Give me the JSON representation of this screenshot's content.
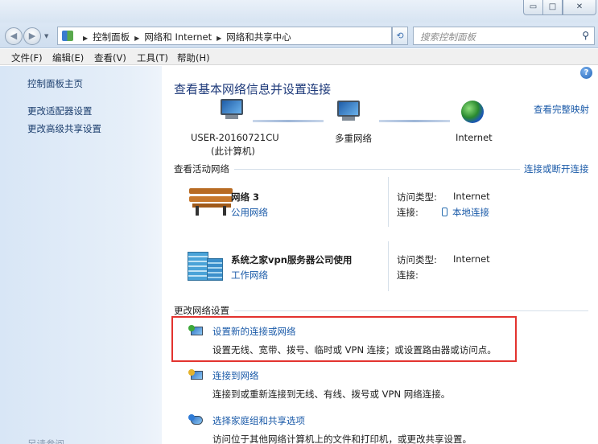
{
  "window": {
    "caption_buttons": {
      "minimize": "▭",
      "maximize": "□",
      "close": "✕"
    }
  },
  "addressbar": {
    "crumbs": [
      "控制面板",
      "网络和 Internet",
      "网络和共享中心"
    ],
    "search_placeholder": "搜索控制面板"
  },
  "menu": [
    "文件(F)",
    "编辑(E)",
    "查看(V)",
    "工具(T)",
    "帮助(H)"
  ],
  "sidebar": {
    "items": [
      "控制面板主页",
      "更改适配器设置",
      "更改高级共享设置"
    ],
    "see_also": "另请参阅"
  },
  "main": {
    "heading": "查看基本网络信息并设置连接",
    "view_full_map": "查看完整映射",
    "map": {
      "computer_name": "USER-20160721CU",
      "computer_sub": "(此计算机)",
      "middle": "多重网络",
      "internet": "Internet"
    },
    "active_section": "查看活动网络",
    "connect_disconnect": "连接或断开连接",
    "networks": [
      {
        "name": "网络  3",
        "type": "公用网络",
        "access_label": "访问类型:",
        "access_value": "Internet",
        "conn_label": "连接:",
        "conn_value": "本地连接"
      },
      {
        "name": "系统之家vpn服务器公司使用",
        "type": "工作网络",
        "access_label": "访问类型:",
        "access_value": "Internet",
        "conn_label": "连接:",
        "conn_value": ""
      }
    ],
    "change_section": "更改网络设置",
    "tasks": [
      {
        "title": "设置新的连接或网络",
        "desc": "设置无线、宽带、拨号、临时或 VPN 连接；或设置路由器或访问点。"
      },
      {
        "title": "连接到网络",
        "desc": "连接到或重新连接到无线、有线、拨号或 VPN 网络连接。"
      },
      {
        "title": "选择家庭组和共享选项",
        "desc": "访问位于其他网络计算机上的文件和打印机，或更改共享设置。"
      }
    ]
  },
  "colors": {
    "link": "#1a5aa8",
    "heading": "#1e3a7a",
    "highlight_border": "#e3332f"
  }
}
